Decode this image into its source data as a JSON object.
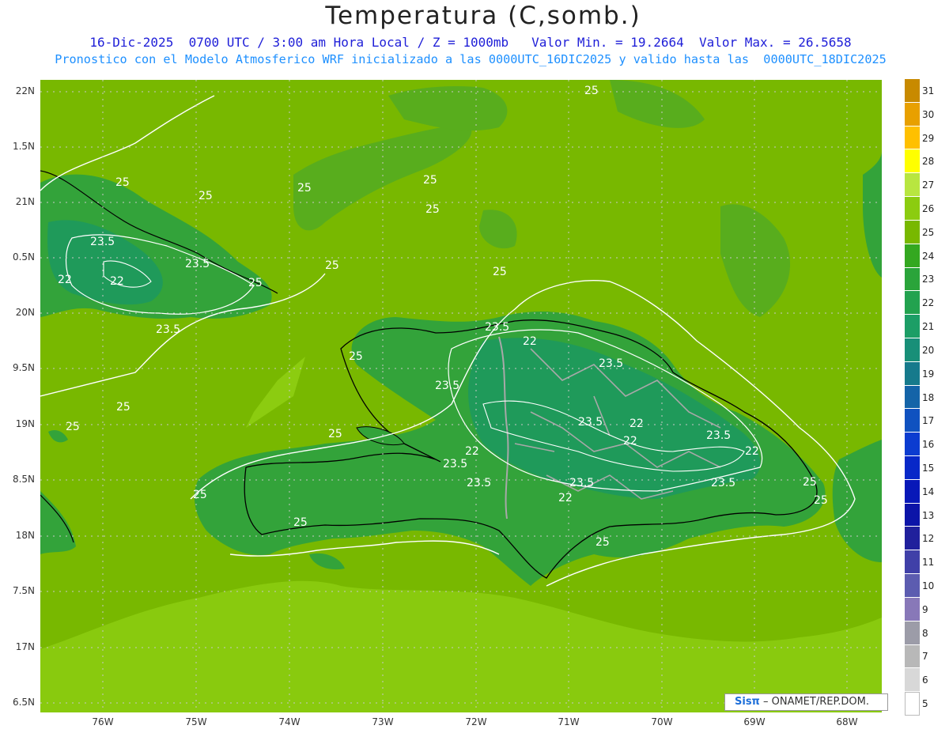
{
  "header": {
    "title": "Temperatura (C,somb.)",
    "subtitle_line1": "16-Dic-2025  0700 UTC / 3:00 am Hora Local / Z = 1000mb   Valor Min. = 19.2664  Valor Max. = 26.5658",
    "subtitle_line2": "Pronostico con el Modelo Atmosferico WRF inicializado a las 0000UTC_16DIC2025 y valido hasta las  0000UTC_18DIC2025"
  },
  "map": {
    "lat_labels": [
      "22N",
      "1.5N",
      "21N",
      "0.5N",
      "20N",
      "9.5N",
      "19N",
      "8.5N",
      "18N",
      "7.5N",
      "17N",
      "6.5N"
    ],
    "lon_labels": [
      "76W",
      "75W",
      "74W",
      "73W",
      "72W",
      "71W",
      "70W",
      "69W",
      "68W"
    ],
    "contour_labels": [
      {
        "text": "25"
      },
      {
        "text": "25"
      },
      {
        "text": "25"
      },
      {
        "text": "25"
      },
      {
        "text": "25"
      },
      {
        "text": "25"
      },
      {
        "text": "25"
      },
      {
        "text": "25"
      },
      {
        "text": "25"
      },
      {
        "text": "25"
      },
      {
        "text": "25"
      },
      {
        "text": "25"
      },
      {
        "text": "25"
      },
      {
        "text": "25"
      },
      {
        "text": "25"
      },
      {
        "text": "25"
      },
      {
        "text": "25"
      },
      {
        "text": "25"
      },
      {
        "text": "23.5"
      },
      {
        "text": "23.5"
      },
      {
        "text": "23.5"
      },
      {
        "text": "23.5"
      },
      {
        "text": "23.5"
      },
      {
        "text": "23.5"
      },
      {
        "text": "23.5"
      },
      {
        "text": "23.5"
      },
      {
        "text": "23.5"
      },
      {
        "text": "23.5"
      },
      {
        "text": "23.5"
      },
      {
        "text": "23.5"
      },
      {
        "text": "22"
      },
      {
        "text": "22"
      },
      {
        "text": "22"
      },
      {
        "text": "22"
      },
      {
        "text": "22"
      },
      {
        "text": "22"
      },
      {
        "text": "22"
      },
      {
        "text": "22"
      }
    ],
    "colors": {
      "sea": "#78b800",
      "land_light": "#58ad1d",
      "land_mid": "#33a33a",
      "land_dark": "#1f9a5a",
      "warm": "#8ccc10",
      "contour": "#ffffff",
      "border": "#a8a8a8",
      "coast": "#000000"
    }
  },
  "colorbar": {
    "labels": [
      "31",
      "30",
      "29",
      "28",
      "27",
      "26",
      "25",
      "24",
      "23",
      "22",
      "21",
      "20",
      "19",
      "18",
      "17",
      "16",
      "15",
      "14",
      "13",
      "12",
      "11",
      "10",
      "9",
      "8",
      "7",
      "6",
      "5"
    ],
    "colors": [
      "#c88a00",
      "#e8a000",
      "#ffc000",
      "#ffff00",
      "#b8e640",
      "#8ccc10",
      "#78b800",
      "#34a820",
      "#2aa43a",
      "#22a24f",
      "#1c9e66",
      "#188f78",
      "#167a8c",
      "#1464a8",
      "#1052c0",
      "#0c3cd0",
      "#0828c8",
      "#0818b8",
      "#0c14a8",
      "#20209c",
      "#4040a8",
      "#5c5cb0",
      "#8878b8",
      "#9c9ca8",
      "#b8b8b8",
      "#d8d8d8",
      "#ffffff"
    ]
  },
  "credit": {
    "logo": "Sisπ",
    "agency": "– ONAMET/REP.DOM."
  }
}
